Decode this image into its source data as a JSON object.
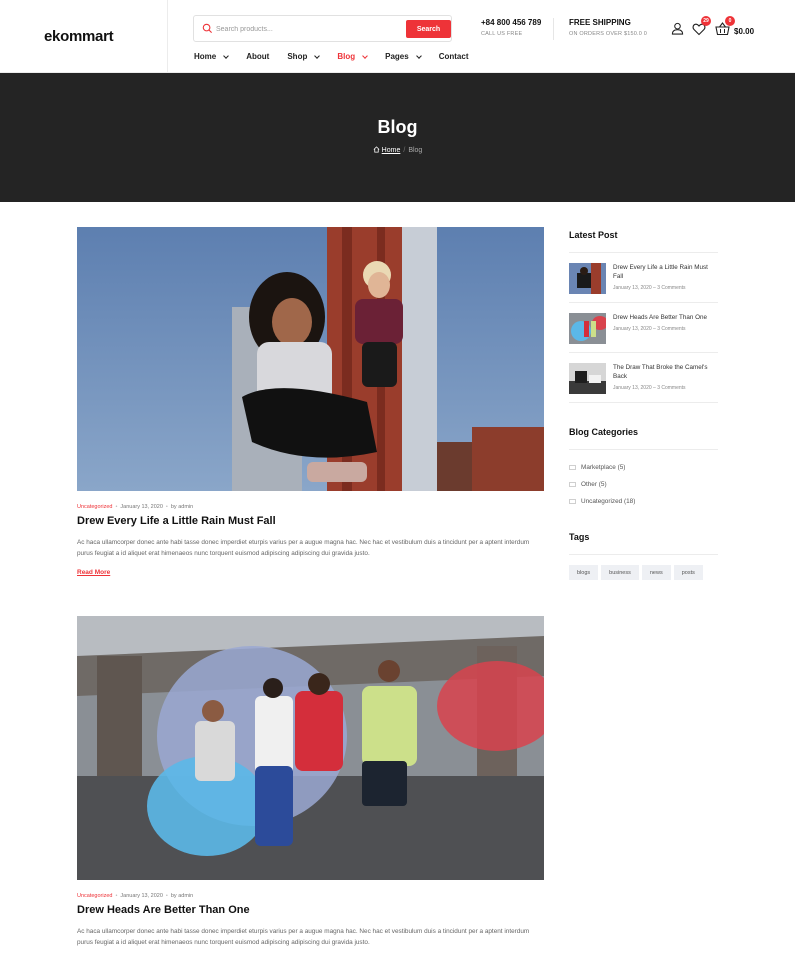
{
  "header": {
    "logo": "ekommart",
    "search_placeholder": "Search products...",
    "search_button": "Search",
    "phone": "+84 800 456 789",
    "phone_caption": "CALL US FREE",
    "shipping_title": "FREE SHIPPING",
    "shipping_caption": "ON ORDERS OVER $150.0 0",
    "wishlist_count": "29",
    "cart_count": "0",
    "cart_total": "$0.00",
    "accent_color": "#ee3338"
  },
  "nav": {
    "items": [
      {
        "label": "Home"
      },
      {
        "label": "About"
      },
      {
        "label": "Shop"
      },
      {
        "label": "Blog"
      },
      {
        "label": "Pages"
      },
      {
        "label": "Contact"
      }
    ]
  },
  "banner": {
    "title": "Blog",
    "breadcrumb_home": "Home",
    "breadcrumb_current": "Blog"
  },
  "posts": [
    {
      "category": "Uncategorized",
      "date": "January 13, 2020",
      "author": "by admin",
      "title": "Drew Every Life a Little Rain Must Fall",
      "excerpt": "Ac haca ullamcorper donec ante habi tasse donec imperdiet eturpis varius per a augue magna hac. Nec hac et vestibulum duis a tincidunt per a aptent interdum purus feugiat a id aliquet erat himenaeos nunc torquent euismod adipiscing adipiscing dui gravida justo.",
      "read_more": "Read More"
    },
    {
      "category": "Uncategorized",
      "date": "January 13, 2020",
      "author": "by admin",
      "title": "Drew Heads Are Better Than One",
      "excerpt": "Ac haca ullamcorper donec ante habi tasse donec imperdiet eturpis varius per a augue magna hac. Nec hac et vestibulum duis a tincidunt per a aptent interdum purus feugiat a id aliquet erat himenaeos nunc torquent euismod adipiscing adipiscing dui gravida justo."
    }
  ],
  "sidebar": {
    "latest_title": "Latest Post",
    "latest": [
      {
        "title": "Drew Every Life a Little Rain Must Fall",
        "meta": "January 13, 2020 – 3 Comments"
      },
      {
        "title": "Drew Heads Are Better Than One",
        "meta": "January 13, 2020 – 3 Comments"
      },
      {
        "title": "The Draw That Broke the Camel's Back",
        "meta": "January 13, 2020 – 3 Comments"
      }
    ],
    "categories_title": "Blog Categories",
    "categories": [
      {
        "label": "Marketplace (5)"
      },
      {
        "label": "Other (5)"
      },
      {
        "label": "Uncategorized (18)"
      }
    ],
    "tags_title": "Tags",
    "tags": [
      "blogs",
      "business",
      "news",
      "posts"
    ]
  }
}
